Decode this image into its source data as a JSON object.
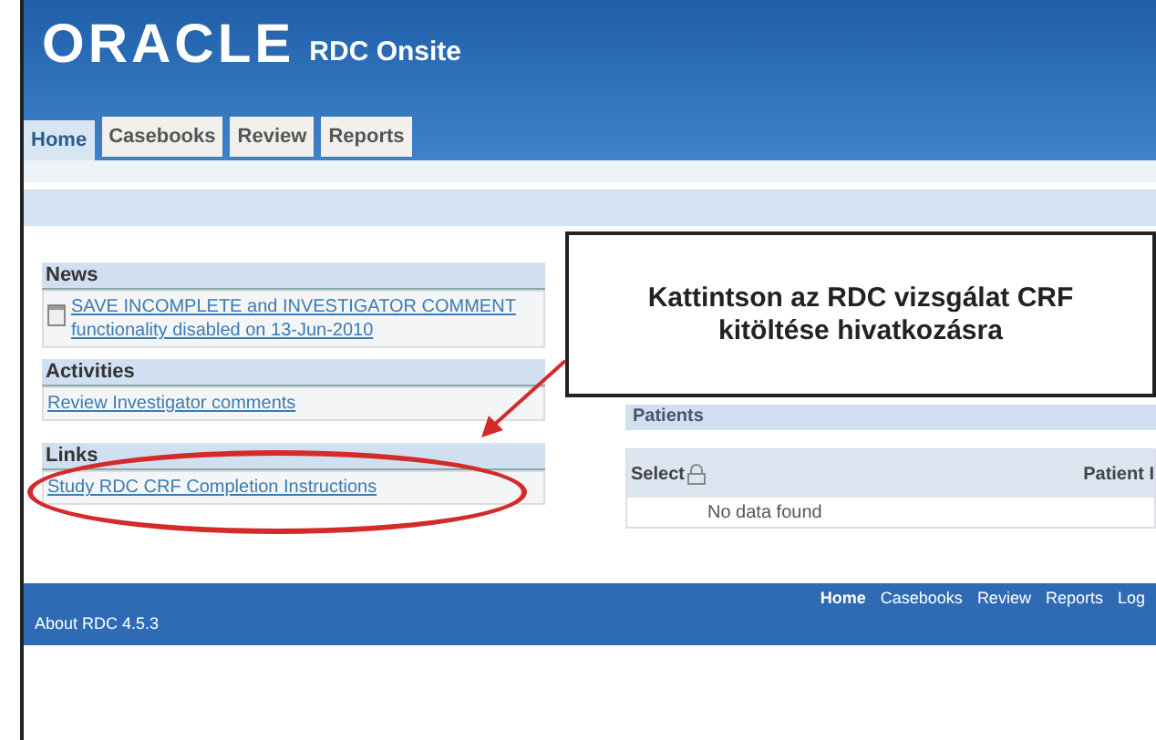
{
  "header": {
    "logo": "ORACLE",
    "product": "RDC Onsite"
  },
  "tabs": [
    {
      "label": "Home",
      "selected": true
    },
    {
      "label": "Casebooks",
      "selected": false
    },
    {
      "label": "Review",
      "selected": false
    },
    {
      "label": "Reports",
      "selected": false
    }
  ],
  "panels": [
    {
      "title": "News",
      "items": [
        {
          "text": "SAVE INCOMPLETE and INVESTIGATOR COMMENT functionality disabled on 13-Jun-2010",
          "kind": "news"
        }
      ]
    },
    {
      "title": "Activities",
      "items": [
        {
          "text": "Review Investigator comments",
          "kind": "link"
        }
      ]
    },
    {
      "title": "Links",
      "items": [
        {
          "text": "Study RDC CRF Completion Instructions",
          "kind": "link"
        }
      ],
      "highlighted": true
    }
  ],
  "patients": {
    "title": "Patients",
    "columns": [
      "Select",
      "Patient I"
    ],
    "empty_text": "No data found"
  },
  "callout": {
    "text": "Kattintson az RDC vizsgálat CRF kitöltése hivatkozásra"
  },
  "footer": {
    "links": [
      {
        "label": "Home",
        "selected": true
      },
      {
        "label": "Casebooks",
        "selected": false
      },
      {
        "label": "Review",
        "selected": false
      },
      {
        "label": "Reports",
        "selected": false
      },
      {
        "label": "Log",
        "selected": false
      }
    ],
    "about": "About RDC 4.5.3"
  }
}
